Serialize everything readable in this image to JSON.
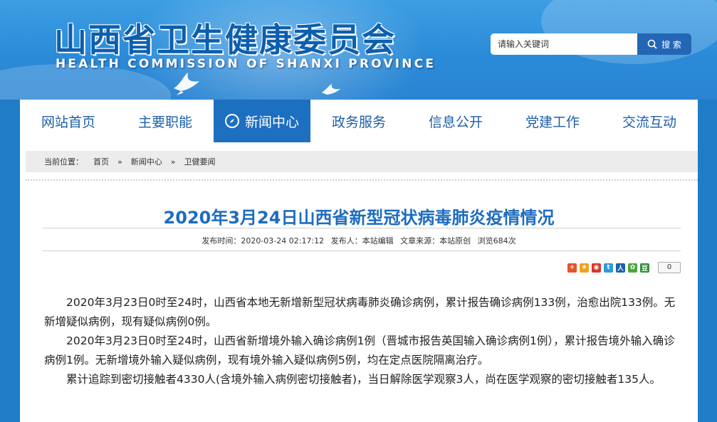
{
  "header": {
    "title": "山西省卫生健康委员会",
    "subtitle": "HEALTH COMMISSION OF SHANXI PROVINCE"
  },
  "search": {
    "placeholder": "请输入关键词",
    "button_label": "搜 索"
  },
  "nav": {
    "items": [
      {
        "label": "网站首页",
        "active": false
      },
      {
        "label": "主要职能",
        "active": false
      },
      {
        "label": "新闻中心",
        "active": true
      },
      {
        "label": "政务服务",
        "active": false
      },
      {
        "label": "信息公开",
        "active": false
      },
      {
        "label": "党建工作",
        "active": false
      },
      {
        "label": "交流互动",
        "active": false
      }
    ]
  },
  "breadcrumb": {
    "prefix": "当前位置：",
    "items": [
      "首页",
      "新闻中心",
      "卫健要闻"
    ],
    "separator": "»"
  },
  "article": {
    "title": "2020年3月24日山西省新型冠状病毒肺炎疫情情况",
    "publish_time": "发布时间：2020-03-24 02:17:12",
    "publisher": "发布人：本站编辑",
    "source": "文章来源：本站原创",
    "views": "浏览684次",
    "share_count": "0",
    "paragraphs": [
      "2020年3月23日0时至24时，山西省本地无新增新型冠状病毒肺炎确诊病例，累计报告确诊病例133例，治愈出院133例。无新增疑似病例，现有疑似病例0例。",
      "2020年3月23日0时至24时，山西省新增境外输入确诊病例1例（晋城市报告英国输入确诊病例1例），累计报告境外输入确诊病例1例。无新增境外输入疑似病例，现有境外输入疑似病例5例，均在定点医院隔离治疗。",
      "累计追踪到密切接触者4330人(含境外输入病例密切接触者)，当日解除医学观察3人，尚在医学观察的密切接触者135人。"
    ]
  },
  "share_icons": [
    {
      "name": "share-more-icon",
      "color": "#e8542a",
      "glyph": "+"
    },
    {
      "name": "qzone-icon",
      "color": "#f2a21a",
      "glyph": "★"
    },
    {
      "name": "weibo-icon",
      "color": "#d9362b",
      "glyph": "微"
    },
    {
      "name": "tencent-weibo-icon",
      "color": "#2b9bd8",
      "glyph": "t"
    },
    {
      "name": "renren-icon",
      "color": "#1f5fa8",
      "glyph": "人"
    },
    {
      "name": "kaixin-icon",
      "color": "#4aa83a",
      "glyph": "✿"
    },
    {
      "name": "douban-icon",
      "color": "#2f8f3a",
      "glyph": "豆"
    }
  ],
  "colors": {
    "header_blue": "#2b8bd8",
    "nav_active": "#1d6fc0",
    "nav_text": "#1e5fa8",
    "title_blue": "#1e6cc0",
    "search_button": "#2466b6"
  }
}
